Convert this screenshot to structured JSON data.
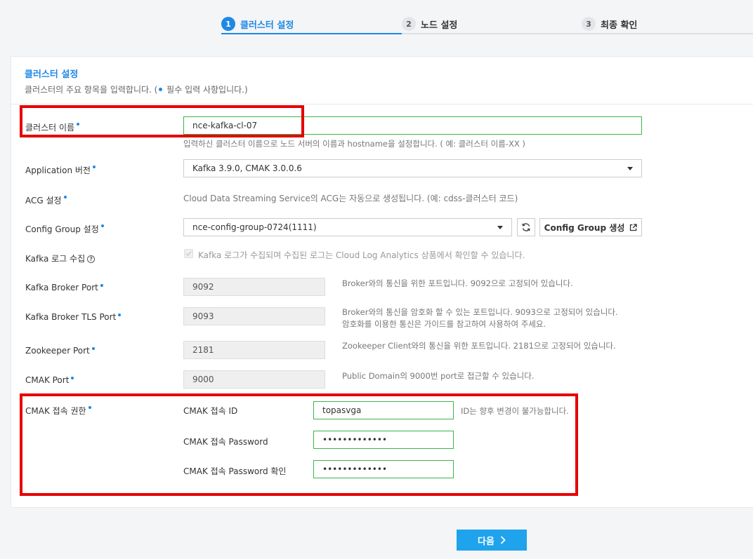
{
  "stepper": {
    "steps": [
      {
        "num": "1",
        "label": "클러스터 설정"
      },
      {
        "num": "2",
        "label": "노드 설정"
      },
      {
        "num": "3",
        "label": "최종 확인"
      }
    ]
  },
  "panel": {
    "title": "클러스터 설정",
    "desc_prefix": "클러스터의 주요 항목을 입력합니다. (",
    "desc_suffix": " 필수 입력 사항입니다.)"
  },
  "fields": {
    "cluster_name": {
      "label": "클러스터 이름",
      "value": "nce-kafka-cl-07",
      "help": "입력하신 클러스터 이름으로 노드 서버의 이름과 hostname을 설정합니다. ( 예: 클러스터 이름-XX )"
    },
    "app_version": {
      "label": "Application 버전",
      "value": "Kafka 3.9.0, CMAK 3.0.0.6"
    },
    "acg": {
      "label": "ACG 설정",
      "text": "Cloud Data Streaming Service의 ACG는 자동으로 생성됩니다. (예: cdss-클러스터 코드)"
    },
    "config_group": {
      "label": "Config Group 설정",
      "value": "nce-config-group-0724(1111)",
      "create_label": "Config Group 생성"
    },
    "kafka_log": {
      "label": "Kafka 로그 수집",
      "text": "Kafka 로그가 수집되며 수집된 로그는 Cloud Log Analytics 상품에서 확인할 수 있습니다."
    },
    "broker_port": {
      "label": "Kafka Broker Port",
      "value": "9092",
      "help": "Broker와의 통신을 위한 포트입니다. 9092으로 고정되어 있습니다."
    },
    "broker_tls_port": {
      "label": "Kafka Broker TLS Port",
      "value": "9093",
      "help1": "Broker와의 통신을 암호화 할 수 있는 포트입니다. 9093으로 고정되어 있습니다.",
      "help2": "암호화를 이용한 통신은 가이드를 참고하여 사용하여 주세요."
    },
    "zookeeper_port": {
      "label": "Zookeeper Port",
      "value": "2181",
      "help": "Zookeeper Client와의 통신을 위한 포트입니다. 2181으로 고정되어 있습니다."
    },
    "cmak_port": {
      "label": "CMAK Port",
      "value": "9000",
      "help": "Public Domain의 9000번 port로 접근할 수 있습니다."
    },
    "cmak_access": {
      "label": "CMAK 접속 권한",
      "id_label": "CMAK 접속 ID",
      "id_value": "topasvga",
      "id_help": "ID는 향후 변경이 불가능합니다.",
      "pw_label": "CMAK 접속 Password",
      "pw_value": "•••••••••••••",
      "pw_confirm_label": "CMAK 접속 Password 확인",
      "pw_confirm_value": "•••••••••••••"
    }
  },
  "footer": {
    "next_label": "다음"
  },
  "colors": {
    "accent": "#1e88e5",
    "primary_button": "#1fa3ec",
    "valid_border": "#3bb64b",
    "annotation_red": "#e60000"
  }
}
